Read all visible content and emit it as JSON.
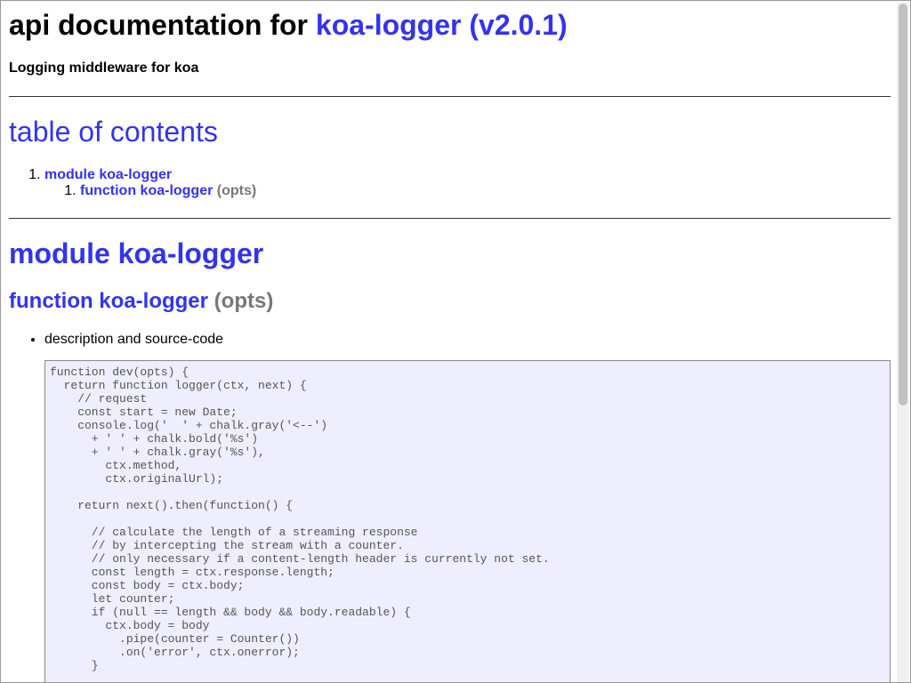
{
  "header": {
    "title_prefix": "api documentation for ",
    "package_link": "koa-logger (v2.0.1)",
    "subtitle": "Logging middleware for koa"
  },
  "toc": {
    "heading": "table of contents",
    "items": [
      {
        "label": "module koa-logger",
        "children": [
          {
            "label": "function koa-logger",
            "args": "(opts)"
          }
        ]
      }
    ]
  },
  "module": {
    "heading": "module koa-logger",
    "function_name": "function koa-logger",
    "function_args": "(opts)",
    "bullet": "description and source-code",
    "source_code": "function dev(opts) {\n  return function logger(ctx, next) {\n    // request\n    const start = new Date;\n    console.log('  ' + chalk.gray('<--')\n      + ' ' + chalk.bold('%s')\n      + ' ' + chalk.gray('%s'),\n        ctx.method,\n        ctx.originalUrl);\n\n    return next().then(function() {\n\n      // calculate the length of a streaming response\n      // by intercepting the stream with a counter.\n      // only necessary if a content-length header is currently not set.\n      const length = ctx.response.length;\n      const body = ctx.body;\n      let counter;\n      if (null == length && body && body.readable) {\n        ctx.body = body\n          .pipe(counter = Counter())\n          .on('error', ctx.onerror);\n      }\n\n      // log when the response is finished or closed,\n      // whichever happens first."
  },
  "colors": {
    "link": "#3333ee",
    "args": "#777777",
    "code_bg": "#eeeeff"
  }
}
